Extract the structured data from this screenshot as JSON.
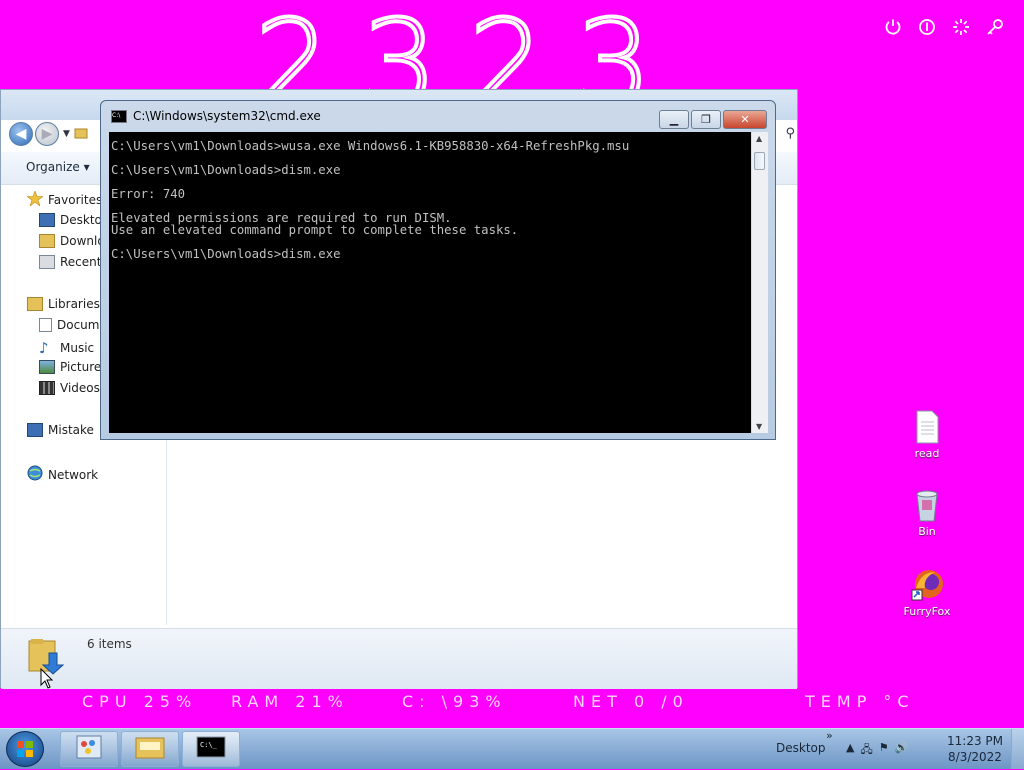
{
  "desktop": {
    "clock_digits": "2323",
    "stats": {
      "cpu": "CPU 25%",
      "ram": "RAM 21%",
      "disk": "C: \\93%",
      "net": "NET 0 /0",
      "temp": "TEMP °C"
    },
    "icons": [
      {
        "label": "read",
        "icon": "text-file-icon"
      },
      {
        "label": "Bin",
        "icon": "recycle-bin-icon"
      },
      {
        "label": "FurryFox",
        "icon": "firefox-shortcut-icon"
      }
    ],
    "top_icons": [
      "power-icon",
      "info-icon",
      "settings-icon",
      "key-icon"
    ]
  },
  "explorer": {
    "toolbar": {
      "organize_label": "Organize ▾"
    },
    "nav": {
      "favorites": "Favorites",
      "desktop": "Desktop",
      "downloads": "Downloads",
      "recent": "Recent Places",
      "libraries": "Libraries",
      "documents": "Documents",
      "music": "Music",
      "pictures": "Pictures",
      "videos": "Videos",
      "mistake": "Mistake",
      "network": "Network"
    },
    "status": {
      "item_count": "6 items"
    }
  },
  "cmd": {
    "title": "C:\\Windows\\system32\\cmd.exe",
    "lines": [
      "C:\\Users\\vm1\\Downloads>wusa.exe Windows6.1-KB958830-x64-RefreshPkg.msu",
      "",
      "C:\\Users\\vm1\\Downloads>dism.exe",
      "",
      "Error: 740",
      "",
      "Elevated permissions are required to run DISM.",
      "Use an elevated command prompt to complete these tasks.",
      "",
      "C:\\Users\\vm1\\Downloads>dism.exe"
    ]
  },
  "taskbar": {
    "desktop_label": "Desktop",
    "time": "11:23 PM",
    "date": "8/3/2022",
    "chevron": "»"
  }
}
